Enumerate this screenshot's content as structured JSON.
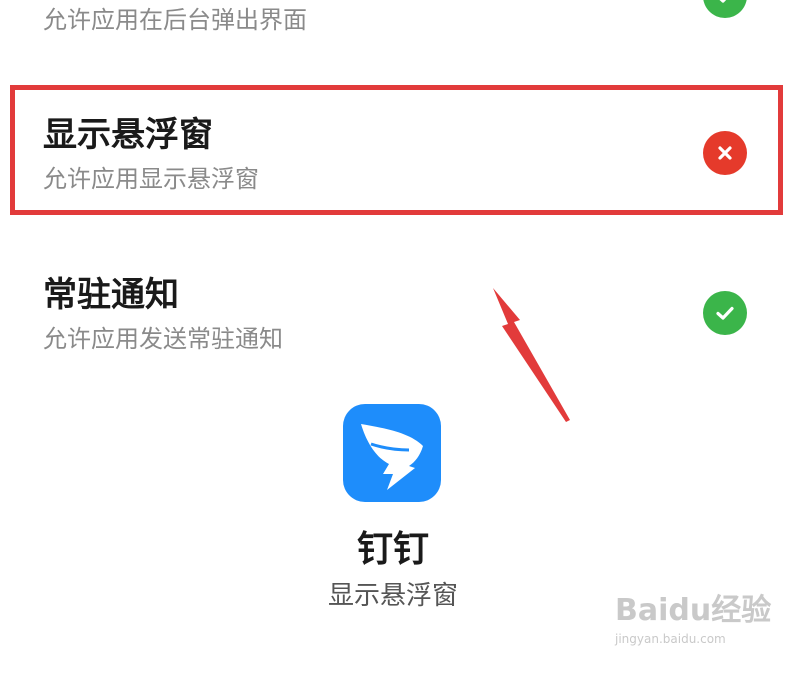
{
  "rows": [
    {
      "description": "允许应用在后台弹出界面",
      "status": "allowed"
    },
    {
      "title": "显示悬浮窗",
      "description": "允许应用显示悬浮窗",
      "status": "denied"
    },
    {
      "title": "常驻通知",
      "description": "允许应用发送常驻通知",
      "status": "allowed"
    }
  ],
  "app": {
    "name": "钉钉",
    "permission": "显示悬浮窗",
    "icon": "dingtalk-icon"
  },
  "watermark": {
    "logo": "Baidu经验",
    "url": "jingyan.baidu.com"
  },
  "colors": {
    "allowed": "#3bb54a",
    "denied": "#e53a2b",
    "highlight": "#e23b3b",
    "app_icon_bg": "#1e8dfb"
  }
}
